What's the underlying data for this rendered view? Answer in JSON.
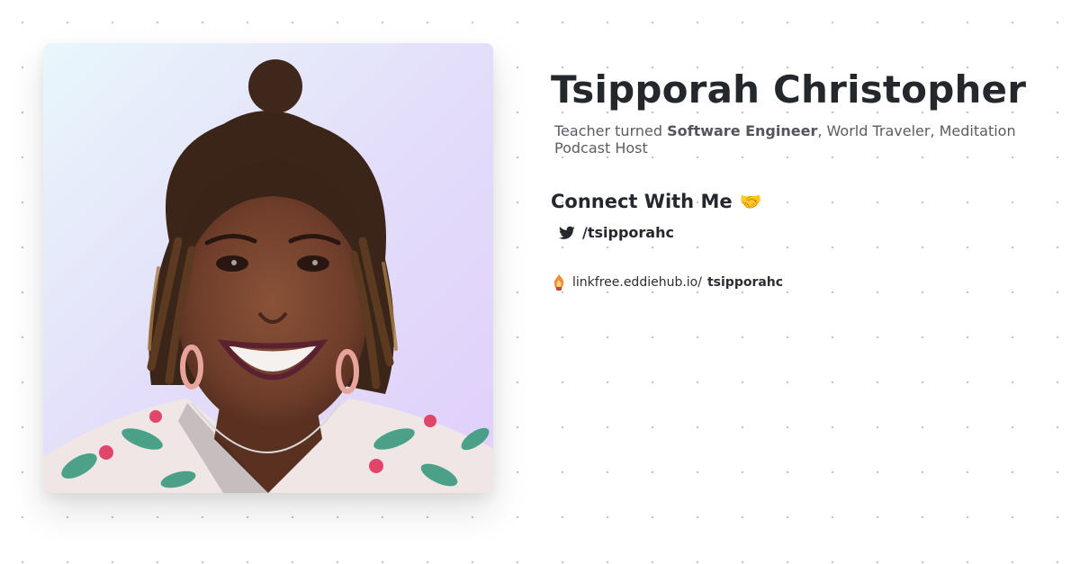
{
  "profile": {
    "name": "Tsipporah Christopher",
    "bio_prefix": "Teacher turned ",
    "bio_highlight": "Software Engineer",
    "bio_suffix": ", World Traveler, Meditation Podcast Host",
    "photo_icon": "profile-photo"
  },
  "connect": {
    "heading": "Connect With Me",
    "heading_emoji": "🤝",
    "links": [
      {
        "icon": "twitter-icon",
        "label": "/tsipporahc"
      }
    ]
  },
  "footer": {
    "icon": "linkfree-logo-icon",
    "domain": "linkfree.eddiehub.io/",
    "username": "tsipporahc"
  },
  "colors": {
    "text_primary": "#24272c",
    "text_secondary": "#595d63",
    "dot_grid": "#c4c4c4"
  }
}
